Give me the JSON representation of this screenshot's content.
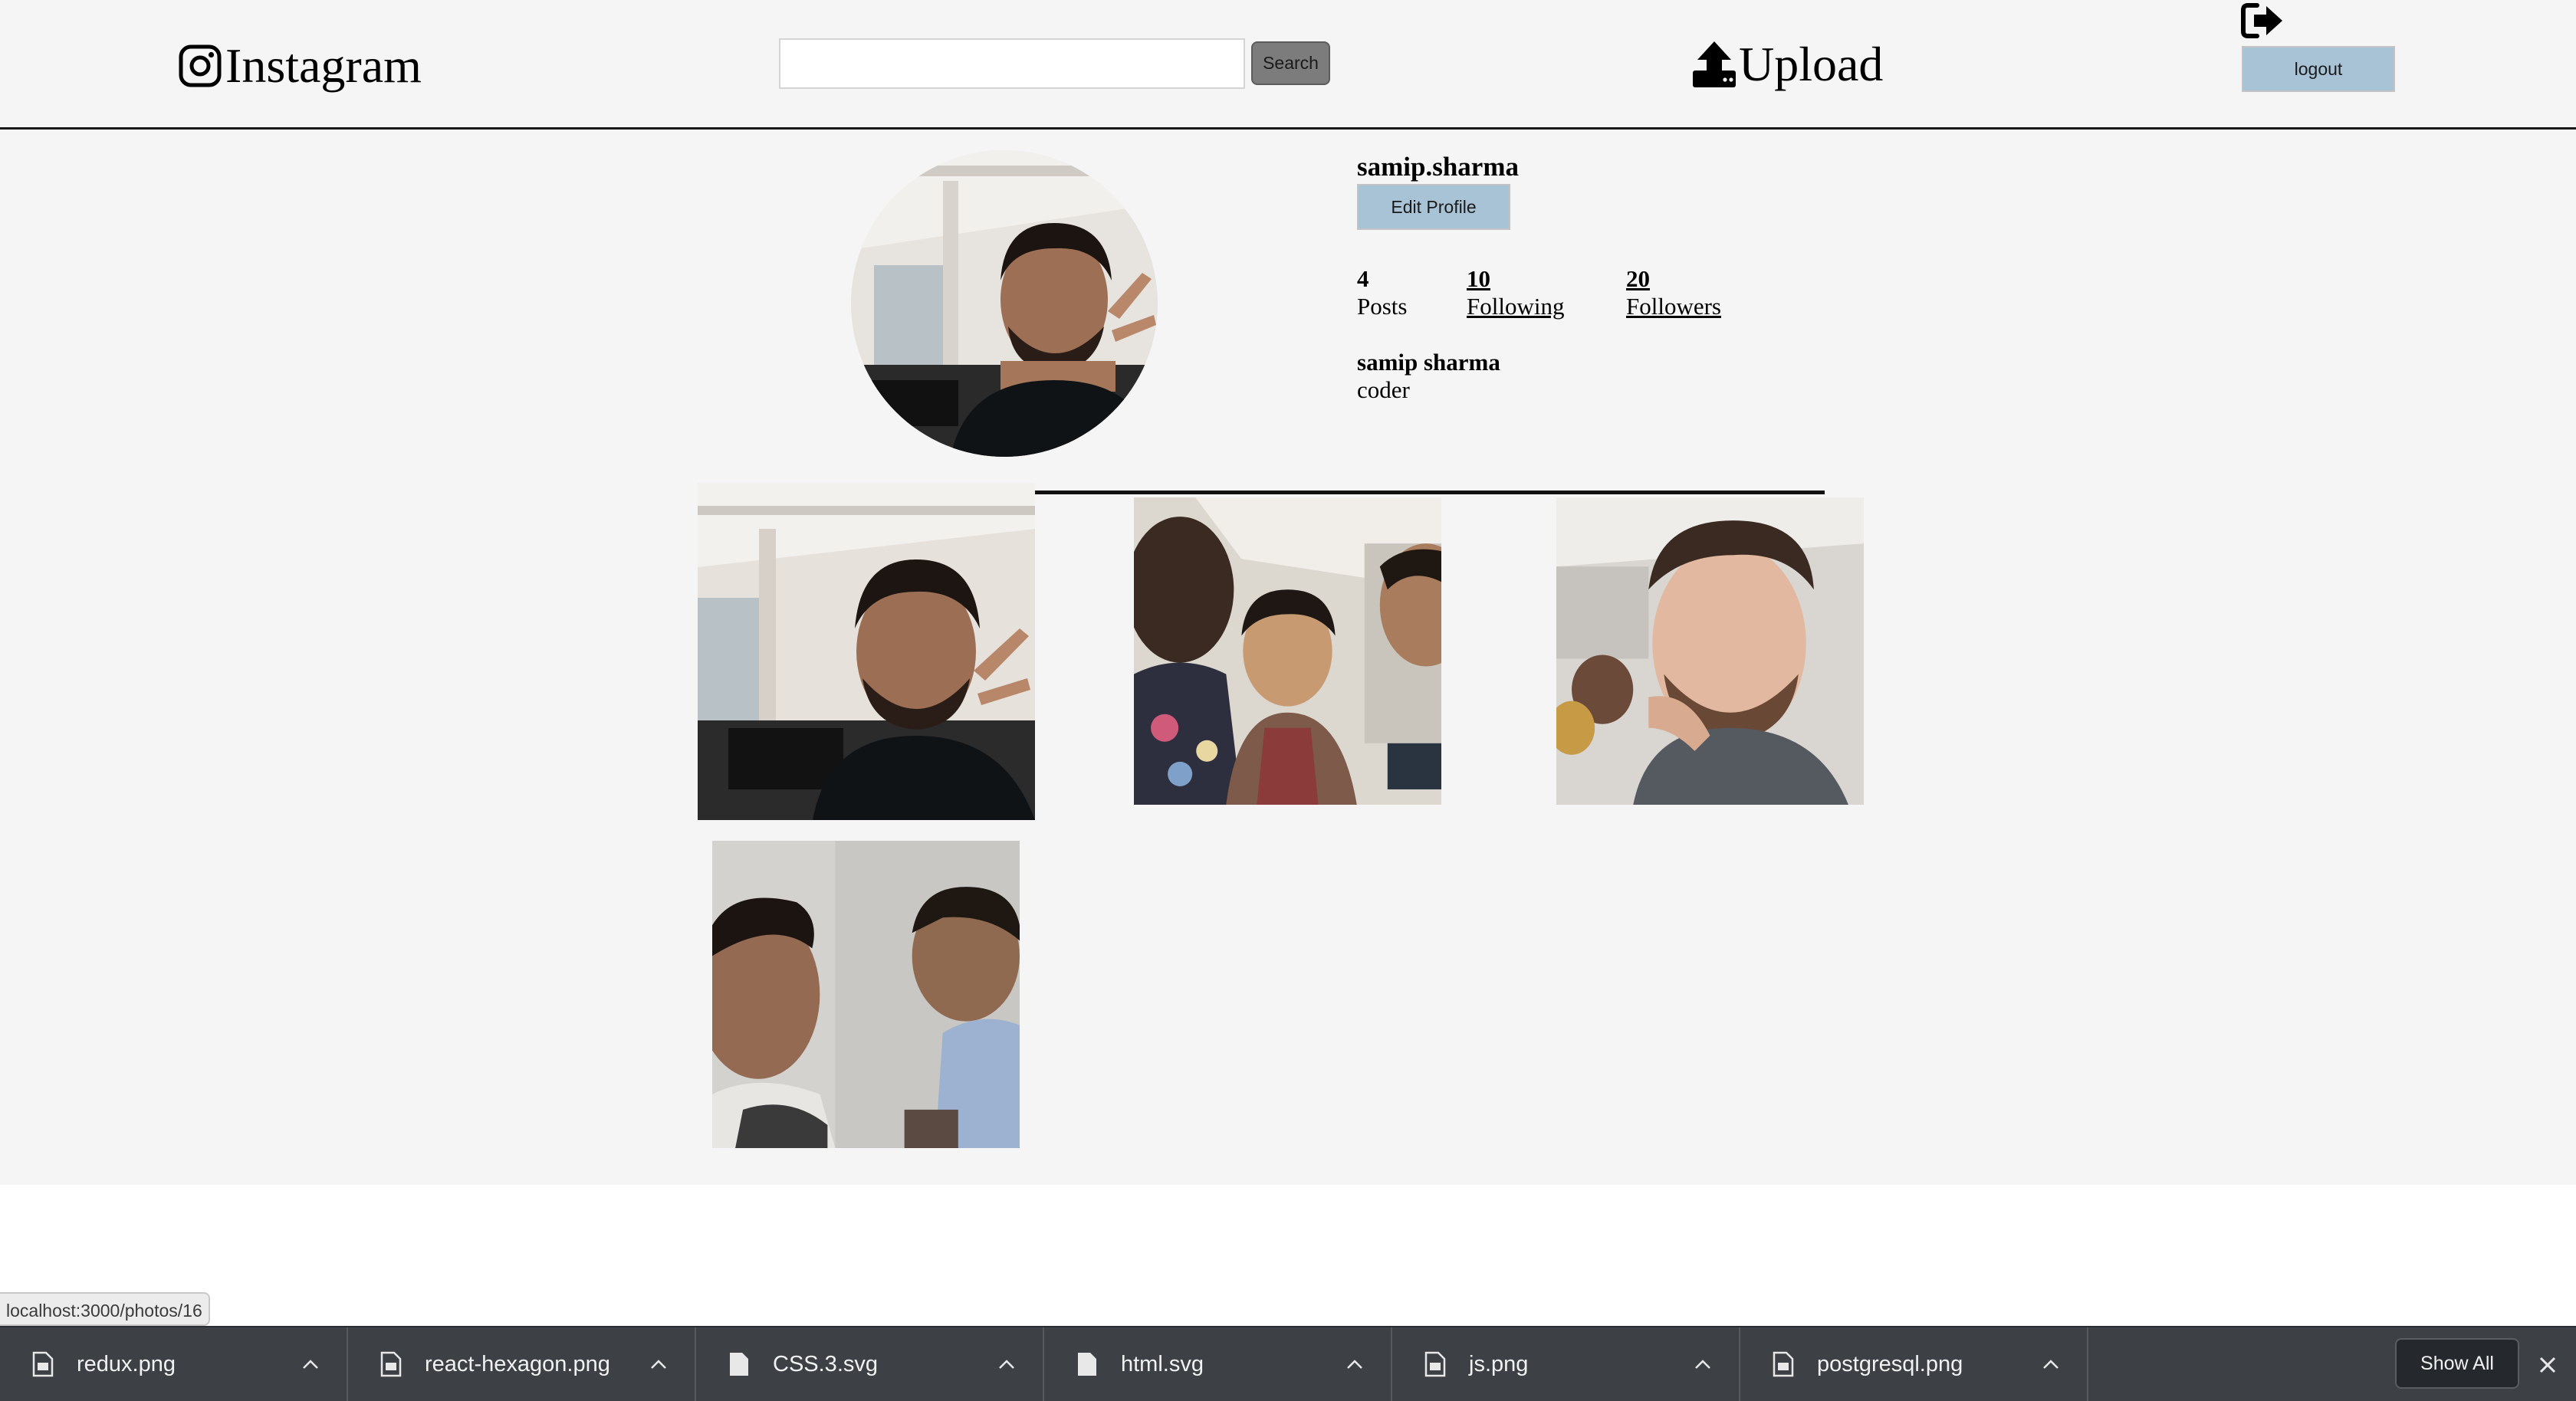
{
  "navbar": {
    "brand": "Instagram",
    "search_placeholder": "",
    "search_button": "Search",
    "upload": "Upload",
    "logout": "logout"
  },
  "profile": {
    "username": "samip.sharma",
    "edit_button": "Edit Profile",
    "stats": [
      {
        "value": "4",
        "label": "Posts"
      },
      {
        "value": "10",
        "label": "Following"
      },
      {
        "value": "20",
        "label": "Followers"
      }
    ],
    "full_name": "samip sharma",
    "bio": "coder"
  },
  "photos": [
    {
      "id": "photo-1",
      "subject": "selfie with peace sign"
    },
    {
      "id": "photo-2",
      "subject": "group selfie"
    },
    {
      "id": "photo-3",
      "subject": "thinking pose selfie"
    },
    {
      "id": "photo-4",
      "subject": "two friends selfie"
    }
  ],
  "browser": {
    "status_url": "localhost:3000/photos/16",
    "downloads": [
      {
        "name": "redux.png",
        "icon": "image-file-icon"
      },
      {
        "name": "react-hexagon.png",
        "icon": "image-file-icon"
      },
      {
        "name": "CSS.3.svg",
        "icon": "file-icon"
      },
      {
        "name": "html.svg",
        "icon": "file-icon"
      },
      {
        "name": "js.png",
        "icon": "image-file-icon"
      },
      {
        "name": "postgresql.png",
        "icon": "image-file-icon"
      }
    ],
    "show_all": "Show All"
  },
  "colors": {
    "page_bg": "#f5f5f5",
    "button_blue": "#a9c3d6",
    "search_button": "#7c7c7c",
    "shelf_bg": "#3d4146"
  }
}
